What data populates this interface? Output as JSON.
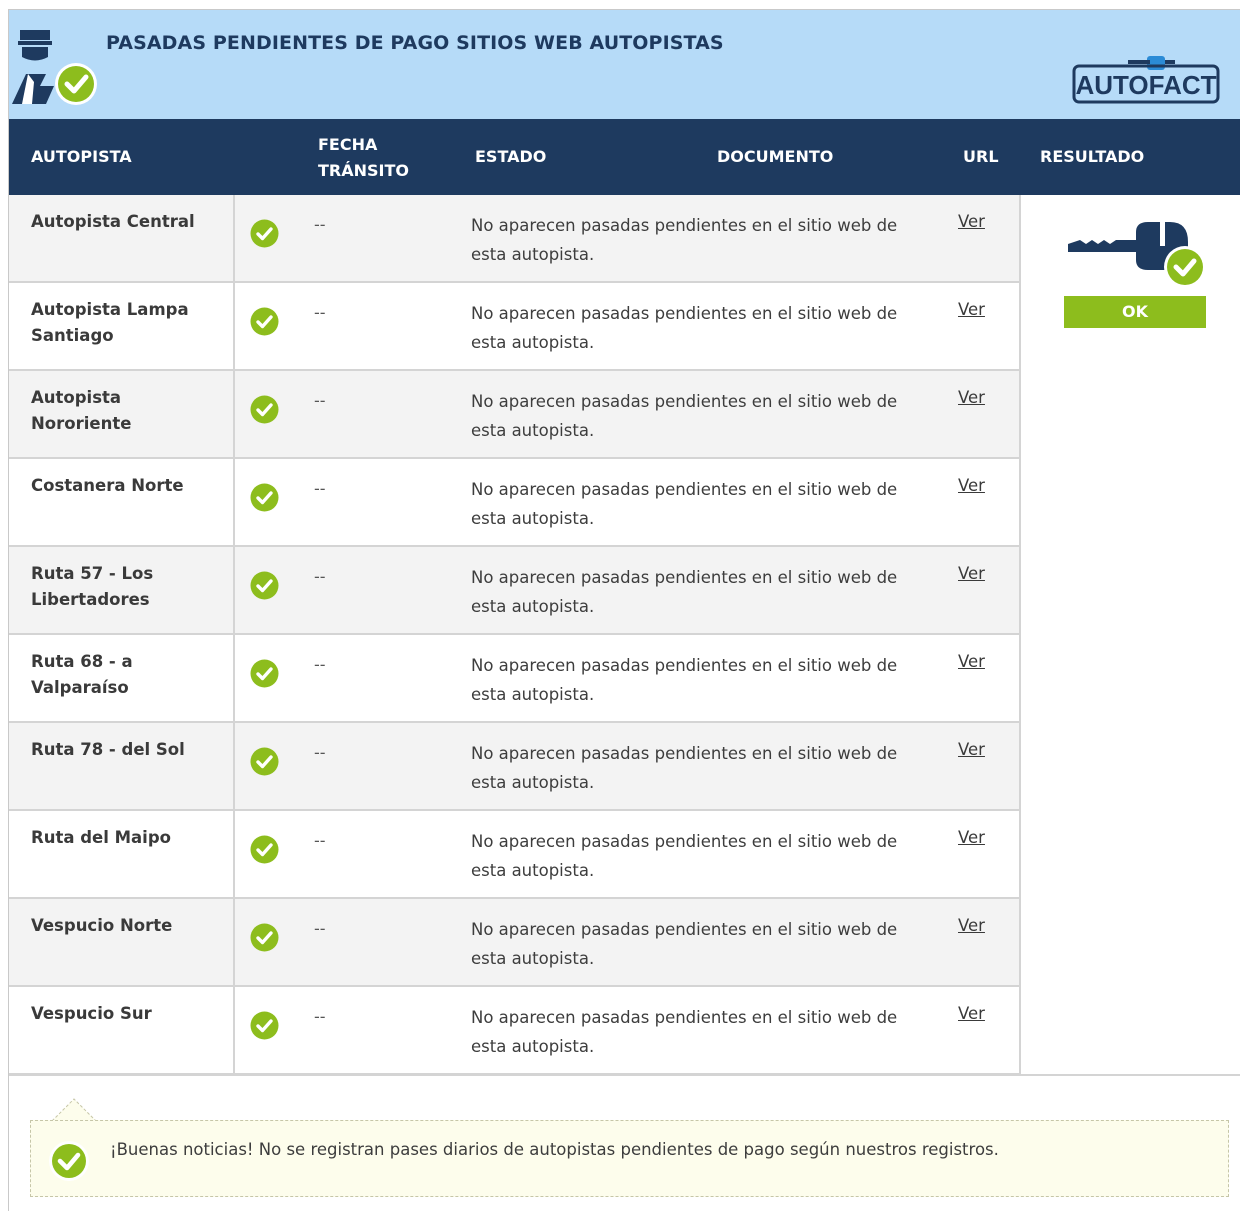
{
  "header": {
    "title": "PASADAS PENDIENTES DE PAGO SITIOS WEB AUTOPISTAS",
    "brand": "AUTOFACT",
    "icon": "officer-check-icon"
  },
  "columns": {
    "autopista": "AUTOPISTA",
    "fecha_line1": "FECHA",
    "fecha_line2": "TRÁNSITO",
    "estado": "ESTADO",
    "documento": "DOCUMENTO",
    "url": "URL",
    "resultado": "RESULTADO"
  },
  "rows": [
    {
      "name": "Autopista Central",
      "fecha": "--",
      "estado": "No aparecen pasadas pendientes en el sitio web de esta autopista.",
      "url": "Ver"
    },
    {
      "name": "Autopista Lampa Santiago",
      "fecha": "--",
      "estado": "No aparecen pasadas pendientes en el sitio web de esta autopista.",
      "url": "Ver"
    },
    {
      "name": "Autopista Nororiente",
      "fecha": "--",
      "estado": "No aparecen pasadas pendientes en el sitio web de esta autopista.",
      "url": "Ver"
    },
    {
      "name": "Costanera Norte",
      "fecha": "--",
      "estado": "No aparecen pasadas pendientes en el sitio web de esta autopista.",
      "url": "Ver"
    },
    {
      "name": "Ruta 57 - Los Libertadores",
      "fecha": "--",
      "estado": "No aparecen pasadas pendientes en el sitio web de esta autopista.",
      "url": "Ver"
    },
    {
      "name": "Ruta 68 - a Valparaíso",
      "fecha": "--",
      "estado": "No aparecen pasadas pendientes en el sitio web de esta autopista.",
      "url": "Ver"
    },
    {
      "name": "Ruta 78 - del Sol",
      "fecha": "--",
      "estado": "No aparecen pasadas pendientes en el sitio web de esta autopista.",
      "url": "Ver"
    },
    {
      "name": "Ruta del Maipo",
      "fecha": "--",
      "estado": "No aparecen pasadas pendientes en el sitio web de esta autopista.",
      "url": "Ver"
    },
    {
      "name": "Vespucio Norte",
      "fecha": "--",
      "estado": "No aparecen pasadas pendientes en el sitio web de esta autopista.",
      "url": "Ver"
    },
    {
      "name": "Vespucio Sur",
      "fecha": "--",
      "estado": "No aparecen pasadas pendientes en el sitio web de esta autopista.",
      "url": "Ver"
    }
  ],
  "result": {
    "label": "OK",
    "icon": "key-check-icon"
  },
  "note": {
    "text": "¡Buenas noticias! No se registran pases diarios de autopistas pendientes de pago según nuestros registros."
  },
  "colors": {
    "header_bg": "#b6dbf8",
    "column_header_bg": "#1e3a5f",
    "check_green": "#8dbd1d",
    "note_bg": "#fdfdec"
  }
}
